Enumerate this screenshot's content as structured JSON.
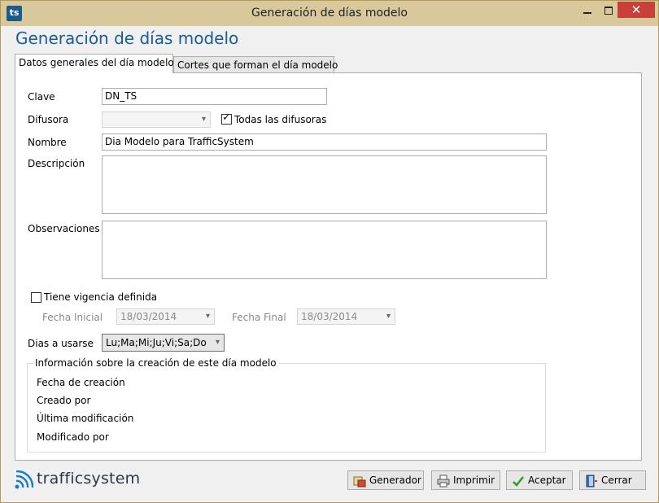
{
  "window": {
    "app_icon": "ts",
    "title": "Generación de días modelo",
    "close_glyph": "✕"
  },
  "form": {
    "heading": "Generación de días modelo",
    "tabs": [
      {
        "label": "Datos generales del día modelo",
        "active": true
      },
      {
        "label": "Cortes que forman el día modelo",
        "active": false
      }
    ],
    "clave": {
      "label": "Clave",
      "value": "DN_TS"
    },
    "difusora": {
      "label": "Difusora",
      "value": "",
      "todas_label": "Todas las difusoras",
      "todas_checked": true
    },
    "nombre": {
      "label": "Nombre",
      "value": "Dia Modelo para TrafficSystem"
    },
    "descripcion": {
      "label": "Descripción",
      "value": ""
    },
    "observaciones": {
      "label": "Observaciones",
      "value": ""
    },
    "vigencia": {
      "label": "Tiene vigencia definida",
      "checked": false,
      "fecha_inicial_label": "Fecha Inicial",
      "fecha_inicial_value": "18/03/2014",
      "fecha_final_label": "Fecha Final",
      "fecha_final_value": "18/03/2014"
    },
    "dias": {
      "label": "Dias a usarse",
      "value": "Lu;Ma;Mi;Ju;Vi;Sa;Do"
    },
    "info": {
      "title": "Información sobre la creación de este día modelo",
      "fecha_creacion_label": "Fecha de creación",
      "creado_por_label": "Creado por",
      "ultima_mod_label": "Última modificación",
      "modificado_por_label": "Modificado por"
    }
  },
  "footer": {
    "logo_text": "trafficsystem",
    "buttons": {
      "generador": "Generador",
      "imprimir": "Imprimir",
      "aceptar": "Aceptar",
      "cerrar": "Cerrar"
    }
  },
  "colors": {
    "titlebar": "#d9c89c",
    "heading": "#1a5a9c",
    "close": "#c7403a",
    "brand_icon": "#1b5a8c"
  }
}
